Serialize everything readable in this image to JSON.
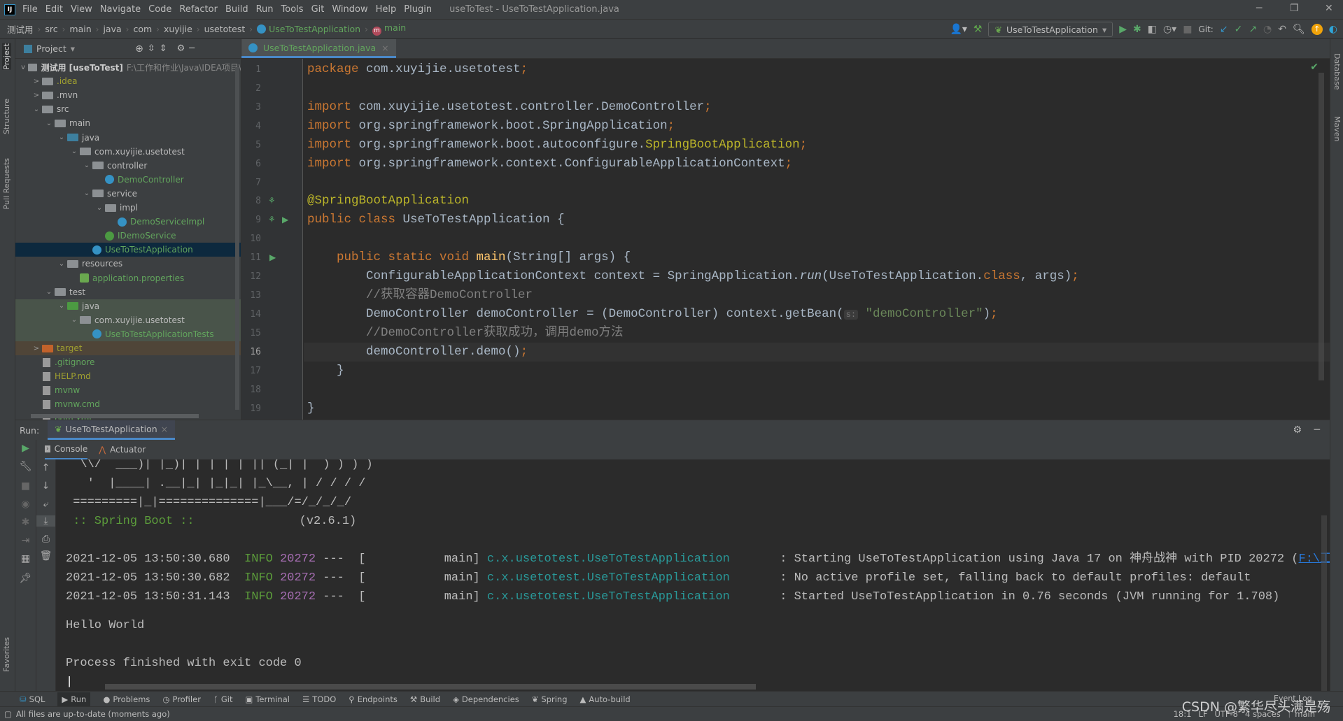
{
  "menu": {
    "items": [
      "File",
      "Edit",
      "View",
      "Navigate",
      "Code",
      "Refactor",
      "Build",
      "Run",
      "Tools",
      "Git",
      "Window",
      "Help",
      "Plugin"
    ],
    "window_title": "useToTest - UseToTestApplication.java"
  },
  "breadcrumb": [
    "测试用",
    "src",
    "main",
    "java",
    "com",
    "xuyijie",
    "usetotest",
    "UseToTestApplication",
    "main"
  ],
  "toolbar": {
    "run_config": "UseToTestApplication",
    "git_label": "Git:"
  },
  "project": {
    "header": "Project",
    "root_name": "测试用 [useToTest]",
    "root_path": "F:\\工作和作业\\Java\\IDEA项目\\",
    "items": [
      {
        "label": ".idea",
        "color": "#a0a030"
      },
      {
        "label": ".mvn",
        "color": "#bbbbbb"
      },
      {
        "label": "src",
        "color": "#bbbbbb"
      },
      {
        "label": "main",
        "color": "#bbbbbb"
      },
      {
        "label": "java",
        "color": "#bbbbbb"
      },
      {
        "label": "com.xuyijie.usetotest",
        "color": "#bbbbbb"
      },
      {
        "label": "controller",
        "color": "#bbbbbb"
      },
      {
        "label": "DemoController",
        "color": "#62a55d"
      },
      {
        "label": "service",
        "color": "#bbbbbb"
      },
      {
        "label": "impl",
        "color": "#bbbbbb"
      },
      {
        "label": "DemoServiceImpl",
        "color": "#62a55d"
      },
      {
        "label": "IDemoService",
        "color": "#62a55d"
      },
      {
        "label": "UseToTestApplication",
        "color": "#62a55d"
      },
      {
        "label": "resources",
        "color": "#bbbbbb"
      },
      {
        "label": "application.properties",
        "color": "#62a55d"
      },
      {
        "label": "test",
        "color": "#bbbbbb"
      },
      {
        "label": "java",
        "color": "#bbbbbb"
      },
      {
        "label": "com.xuyijie.usetotest",
        "color": "#bbbbbb"
      },
      {
        "label": "UseToTestApplicationTests",
        "color": "#62a55d"
      },
      {
        "label": "target",
        "color": "#a0a030"
      },
      {
        "label": ".gitignore",
        "color": "#62a55d"
      },
      {
        "label": "HELP.md",
        "color": "#a0a030"
      },
      {
        "label": "mvnw",
        "color": "#62a55d"
      },
      {
        "label": "mvnw.cmd",
        "color": "#62a55d"
      },
      {
        "label": "pom.xml",
        "color": "#62a55d"
      }
    ]
  },
  "editor": {
    "tab": "UseToTestApplication.java",
    "current_line": 16,
    "param_hint": "s:",
    "lines": [
      [
        [
          "package ",
          "kw"
        ],
        [
          "com.xuyijie.usetotest",
          "pl"
        ],
        [
          ";",
          "kw"
        ]
      ],
      [],
      [
        [
          "import ",
          "kw"
        ],
        [
          "com.xuyijie.usetotest.controller.DemoController",
          "pl"
        ],
        [
          ";",
          "kw"
        ]
      ],
      [
        [
          "import ",
          "kw"
        ],
        [
          "org.springframework.boot.SpringApplication",
          "pl"
        ],
        [
          ";",
          "kw"
        ]
      ],
      [
        [
          "import ",
          "kw"
        ],
        [
          "org.springframework.boot.autoconfigure.",
          "pl"
        ],
        [
          "SpringBootApplication",
          "ann"
        ],
        [
          ";",
          "kw"
        ]
      ],
      [
        [
          "import ",
          "kw"
        ],
        [
          "org.springframework.context.ConfigurableApplicationContext",
          "pl"
        ],
        [
          ";",
          "kw"
        ]
      ],
      [],
      [
        [
          "@SpringBootApplication",
          "ann"
        ]
      ],
      [
        [
          "public class ",
          "kw"
        ],
        [
          "UseToTestApplication {",
          "pl"
        ]
      ],
      [],
      [
        [
          "    public static void ",
          "kw"
        ],
        [
          "main",
          "fn"
        ],
        [
          "(String[] args) {",
          "pl"
        ]
      ],
      [
        [
          "        ConfigurableApplicationContext context = SpringApplication.",
          "pl"
        ],
        [
          "run",
          "pl it"
        ],
        [
          "(UseToTestApplication.",
          "pl"
        ],
        [
          "class",
          "kw"
        ],
        [
          ", args)",
          "pl"
        ],
        [
          ";",
          "kw"
        ]
      ],
      [
        [
          "        //获取容器DemoController",
          "cm"
        ]
      ],
      [
        [
          "        DemoController demoController = (DemoController) context.getBean(",
          "pl"
        ],
        [
          "HINT",
          "hint"
        ],
        [
          "\"demoController\"",
          "str"
        ],
        [
          ")",
          "pl"
        ],
        [
          ";",
          "kw"
        ]
      ],
      [
        [
          "        //DemoController获取成功，调用demo方法",
          "cm"
        ]
      ],
      [
        [
          "        demoController.demo()",
          "pl"
        ],
        [
          ";",
          "kw"
        ]
      ],
      [
        [
          "    }",
          "pl"
        ]
      ],
      [],
      [
        [
          "}",
          "pl"
        ]
      ]
    ]
  },
  "run": {
    "label": "Run:",
    "tab": "UseToTestApplication",
    "subtabs": [
      "Console",
      "Actuator"
    ],
    "banner": [
      "  \\\\/  ___)| |_)| | | | | || (_| |  ) ) ) )",
      "   '  |____| .__|_| |_|_| |_\\__, | / / / /",
      " =========|_|==============|___/=/_/_/_/"
    ],
    "spring_boot": " :: Spring Boot ::",
    "version": "(v2.6.1)",
    "logs": [
      {
        "ts": "2021-12-05 13:50:30.680",
        "level": "INFO",
        "pid": "20272",
        "thread": "---  [           main]",
        "logger": "c.x.usetotest.UseToTestApplication",
        "msg": "       : Starting UseToTestApplication using Java 17 on 神舟战神 with PID 20272 (",
        "link": "F:\\工作和"
      },
      {
        "ts": "2021-12-05 13:50:30.682",
        "level": "INFO",
        "pid": "20272",
        "thread": "---  [           main]",
        "logger": "c.x.usetotest.UseToTestApplication",
        "msg": "       : No active profile set, falling back to default profiles: default",
        "link": ""
      },
      {
        "ts": "2021-12-05 13:50:31.143",
        "level": "INFO",
        "pid": "20272",
        "thread": "---  [           main]",
        "logger": "c.x.usetotest.UseToTestApplication",
        "msg": "       : Started UseToTestApplication in 0.76 seconds (JVM running for 1.708)",
        "link": ""
      }
    ],
    "output": "Hello World",
    "exit": "Process finished with exit code 0"
  },
  "bottom_tabs": [
    "SQL",
    "Run",
    "Problems",
    "Profiler",
    "Git",
    "Terminal",
    "TODO",
    "Endpoints",
    "Build",
    "Dependencies",
    "Spring",
    "Auto-build"
  ],
  "event_log": "Event Log",
  "left_tabs": [
    "Project",
    "Structure",
    "Pull Requests",
    "Favorites"
  ],
  "right_tabs": [
    "Database",
    "Maven"
  ],
  "status": {
    "message": "All files are up-to-date (moments ago)",
    "position": "18:1",
    "line_sep": "LF",
    "encoding": "UTF-8",
    "indent": "4 spaces",
    "branch": "main"
  },
  "watermark": "CSDN @繁华尽头满是殇"
}
